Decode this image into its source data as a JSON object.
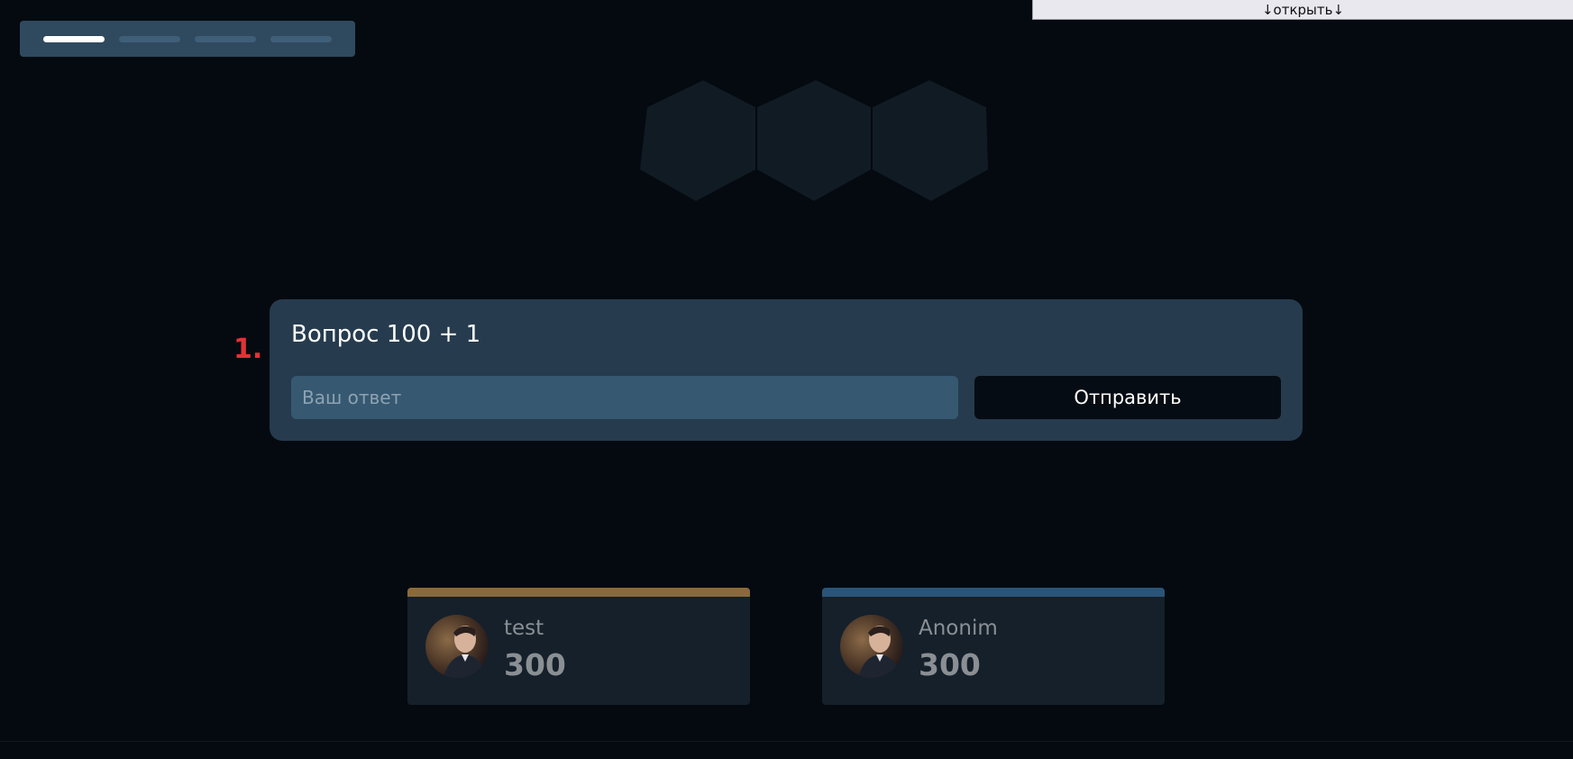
{
  "toggle": {
    "label": "↓открыть↓"
  },
  "steps": {
    "total": 4,
    "current": 1
  },
  "question": {
    "number": "1.",
    "text": "Вопрос 100 + 1",
    "input_placeholder": "Ваш ответ",
    "input_value": "",
    "submit_label": "Отправить"
  },
  "players": [
    {
      "name": "test",
      "score": "300",
      "accent_color": "#8a6a3a"
    },
    {
      "name": "Anonim",
      "score": "300",
      "accent_color": "#2a5578"
    }
  ],
  "colors": {
    "background": "#050a10",
    "card": "#263b4e",
    "question_number": "#e23236"
  }
}
